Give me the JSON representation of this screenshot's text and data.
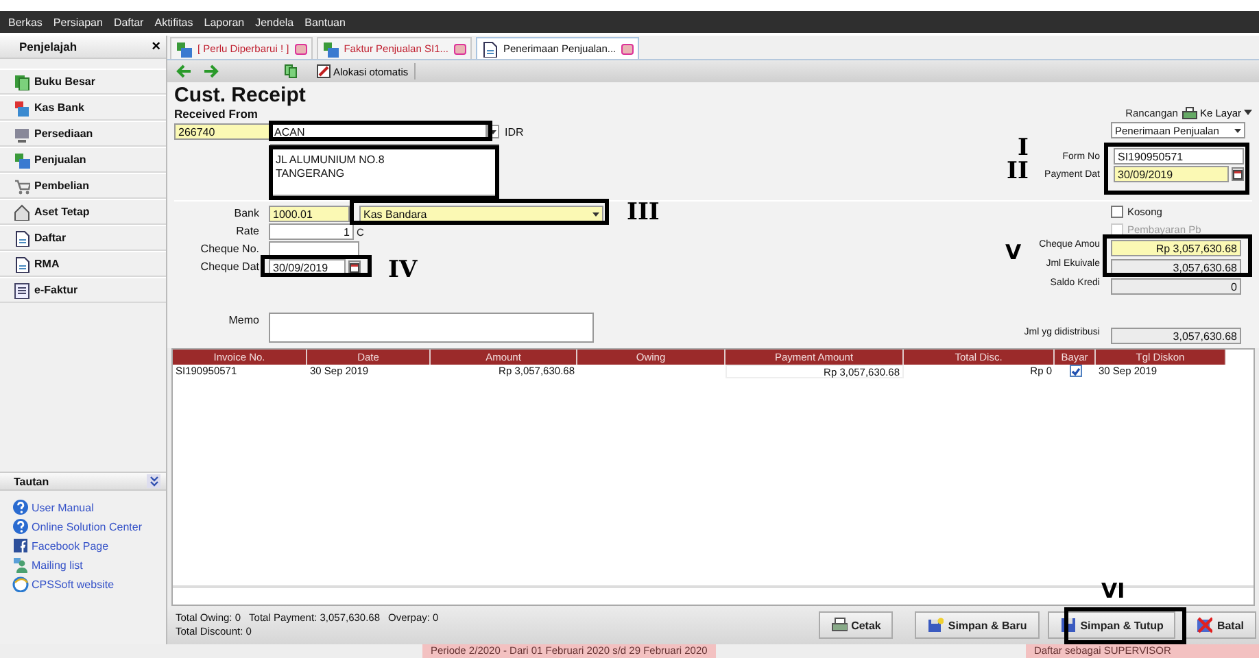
{
  "menu_bar": [
    "Berkas",
    "Persiapan",
    "Daftar",
    "Aktifitas",
    "Laporan",
    "Jendela",
    "Bantuan"
  ],
  "sidebar": {
    "title": "Penjelajah",
    "close": "×",
    "items": [
      {
        "label": "Buku Besar",
        "kind": "ledger"
      },
      {
        "label": "Kas Bank",
        "kind": "cash"
      },
      {
        "label": "Persediaan",
        "kind": "inventory"
      },
      {
        "label": "Penjualan",
        "kind": "sales"
      },
      {
        "label": "Pembelian",
        "kind": "purchase"
      },
      {
        "label": "Aset Tetap",
        "kind": "asset"
      },
      {
        "label": "Daftar",
        "kind": "list"
      },
      {
        "label": "RMA",
        "kind": "list"
      },
      {
        "label": "e-Faktur",
        "kind": "invoice"
      }
    ],
    "links_title": "Tautan",
    "links": [
      {
        "label": "User Manual",
        "kind": "help"
      },
      {
        "label": "Online Solution Center",
        "kind": "help"
      },
      {
        "label": "Facebook Page",
        "kind": "social"
      },
      {
        "label": "Mailing list",
        "kind": "person"
      },
      {
        "label": "CPSSoft website",
        "kind": "web"
      }
    ]
  },
  "tabs": [
    {
      "label": "[ Perlu Diperbarui ! ]",
      "alert": true,
      "selected": false
    },
    {
      "label": "Faktur Penjualan SI1...",
      "alert": true,
      "selected": false
    },
    {
      "label": "Penerimaan Penjualan...",
      "alert": false,
      "selected": true
    }
  ],
  "toolbar": {
    "auto_allocate": "Alokasi otomatis"
  },
  "form": {
    "title": "Cust. Receipt",
    "received_from_label": "Received From",
    "customer_code": "266740",
    "customer_name": "ACAN",
    "currency": "IDR",
    "address": [
      "JL ALUMUNIUM NO.8",
      "TANGERANG"
    ],
    "layout_label": "Rancangan",
    "print_target": "Ke Layar",
    "layout_template": "Penerimaan Penjualan",
    "form_no_label": "Form No",
    "form_no": "SI190950571",
    "payment_date_label": "Payment Dat",
    "payment_date": "30/09/2019",
    "bank_label": "Bank",
    "bank_code": "1000.01",
    "bank_name": "Kas Bandara",
    "rate_label": "Rate",
    "rate": "1",
    "currency_label": "C",
    "cheque_no_label": "Cheque No.",
    "cheque_date_label": "Cheque Dat",
    "cheque_date": "30/09/2019",
    "memo_label": "Memo",
    "options": [
      {
        "label": "Kosong",
        "checked": false,
        "disabled": false
      },
      {
        "label": "Pembayaran Pb",
        "checked": false,
        "disabled": true
      }
    ],
    "cheque_amount_label": "Cheque Amou",
    "cheque_amount": "Rp 3,057,630.68",
    "equivalent_label": "Jml Ekuivale",
    "equivalent": "3,057,630.68",
    "credit_label": "Saldo Kredi",
    "credit": "0",
    "distributed_label": "Jml yg didistribusi",
    "distributed": "3,057,630.68"
  },
  "table": {
    "columns": [
      "Invoice No.",
      "Date",
      "Amount",
      "Owing",
      "Payment Amount",
      "Total Disc.",
      "Bayar",
      "Tgl Diskon"
    ],
    "rows": [
      {
        "invoice_no": "SI190950571",
        "date": "30 Sep 2019",
        "amount": "Rp 3,057,630.68",
        "payment_amount": "Rp 3,057,630.68",
        "total_disc": "Rp 0",
        "paid": true,
        "discount_date": "30 Sep 2019"
      }
    ]
  },
  "totals": [
    "Total Owing: 0",
    "Total Payment: 3,057,630.68",
    "Overpay: 0",
    "Total Discount: 0"
  ],
  "buttons": [
    {
      "label": "Cetak",
      "kind": "print"
    },
    {
      "label": "Simpan & Baru",
      "kind": "save_new"
    },
    {
      "label": "Simpan & Tutup",
      "kind": "save_close"
    },
    {
      "label": "Batal",
      "kind": "cancel"
    }
  ],
  "status_bar": [
    "Periode 2/2020 - Dari 01 Februari 2020 s/d 29 Februari 2020",
    "Daftar sebagai SUPERVISOR"
  ],
  "annotations": [
    {
      "label": "I"
    },
    {
      "label": "II"
    },
    {
      "label": "III"
    },
    {
      "label": "IV"
    },
    {
      "label": "V"
    },
    {
      "label": "VI"
    }
  ]
}
